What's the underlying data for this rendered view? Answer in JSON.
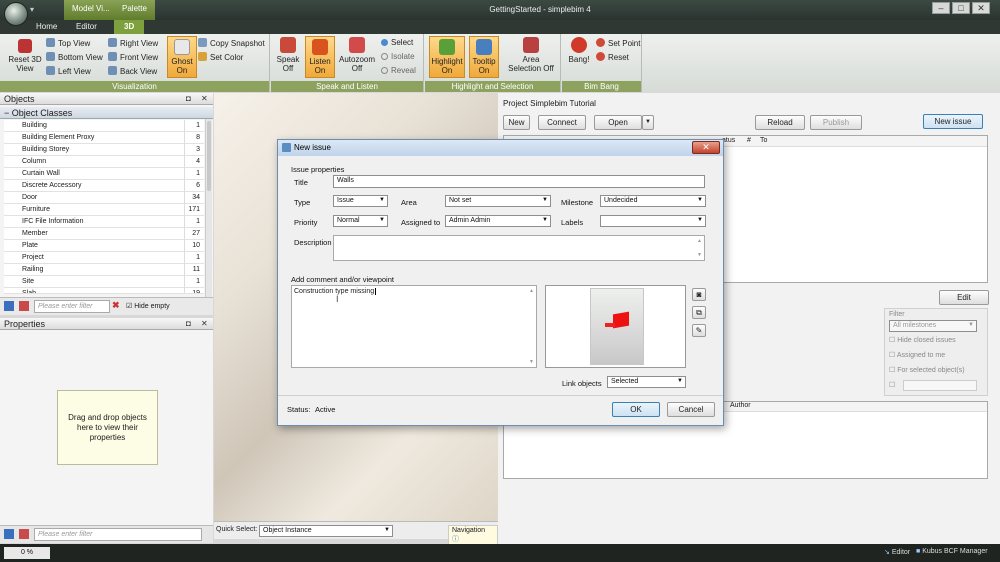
{
  "window": {
    "title": "GettingStarted - simplebim 4",
    "context_tabs": [
      "Model Vi...",
      "Palette"
    ],
    "tabs": [
      "Home",
      "Editor",
      "3D"
    ],
    "active_tab": "3D"
  },
  "ribbon": {
    "visualization": {
      "label": "Visualization",
      "reset": "Reset 3D View",
      "views": [
        "Top View",
        "Bottom View",
        "Left View",
        "Right View",
        "Front View",
        "Back View"
      ],
      "ghost": "Ghost On",
      "snapshot": "Copy Snapshot",
      "set_color": "Set Color"
    },
    "speak": {
      "label": "Speak and Listen",
      "speak": "Speak Off",
      "listen": "Listen On",
      "autozoom": "Autozoom Off",
      "select": "Select",
      "isolate": "Isolate",
      "reveal": "Reveal"
    },
    "highlight": {
      "label": "Highlight and Selection",
      "highlight": "Highlight On",
      "tooltip": "Tooltip On",
      "area": "Area Selection Off"
    },
    "bang": {
      "label": "Bim Bang",
      "bang": "Bang!",
      "set_point": "Set Point",
      "reset": "Reset"
    }
  },
  "objects": {
    "title": "Objects",
    "section": "Object Classes",
    "rows": [
      [
        "Building",
        "1"
      ],
      [
        "Building Element Proxy",
        "8"
      ],
      [
        "Building Storey",
        "3"
      ],
      [
        "Column",
        "4"
      ],
      [
        "Curtain Wall",
        "1"
      ],
      [
        "Discrete Accessory",
        "6"
      ],
      [
        "Door",
        "34"
      ],
      [
        "Furniture",
        "171"
      ],
      [
        "IFC File Information",
        "1"
      ],
      [
        "Member",
        "27"
      ],
      [
        "Plate",
        "10"
      ],
      [
        "Project",
        "1"
      ],
      [
        "Railing",
        "11"
      ],
      [
        "Site",
        "1"
      ],
      [
        "Slab",
        "19"
      ]
    ],
    "filter_placeholder": "Please enter filter",
    "hide_empty": "Hide empty"
  },
  "properties": {
    "title": "Properties",
    "drop_text": "Drag and drop objects here to view their properties",
    "filter_placeholder": "Please enter filter"
  },
  "viewport": {
    "quick_select_label": "Quick Select:",
    "quick_select_value": "Object Instance",
    "navigation": "Navigation"
  },
  "bcf": {
    "project": "Project Simplebim Tutorial",
    "new": "New",
    "connect": "Connect",
    "open": "Open",
    "reload": "Reload",
    "publish": "Publish",
    "new_issue": "New issue",
    "columns": [
      "atus",
      "#",
      "To"
    ],
    "edit": "Edit",
    "filter": "Filter",
    "milestones": "All milestones",
    "hide_closed": "Hide closed issues",
    "assigned": "Assigned to me",
    "for_selected": "For selected object(s)",
    "author": "Author"
  },
  "dialog": {
    "title": "New issue",
    "section": "Issue properties",
    "title_label": "Title",
    "title_value": "Walls",
    "type_label": "Type",
    "type_value": "Issue",
    "area_label": "Area",
    "area_value": "Not set",
    "milestone_label": "Milestone",
    "milestone_value": "Undecided",
    "priority_label": "Priority",
    "priority_value": "Normal",
    "assigned_label": "Assigned to",
    "assigned_value": "Admin Admin",
    "labels_label": "Labels",
    "description_label": "Description",
    "comment_section": "Add comment and/or viewpoint",
    "comment_value": "Construction type missing",
    "link_label": "Link objects",
    "link_value": "Selected",
    "status_label": "Status:",
    "status_value": "Active",
    "ok": "OK",
    "cancel": "Cancel"
  },
  "statusbar": {
    "zoom": "0 %",
    "editor": "Editor",
    "bcf_manager": "Kubus BCF Manager"
  }
}
